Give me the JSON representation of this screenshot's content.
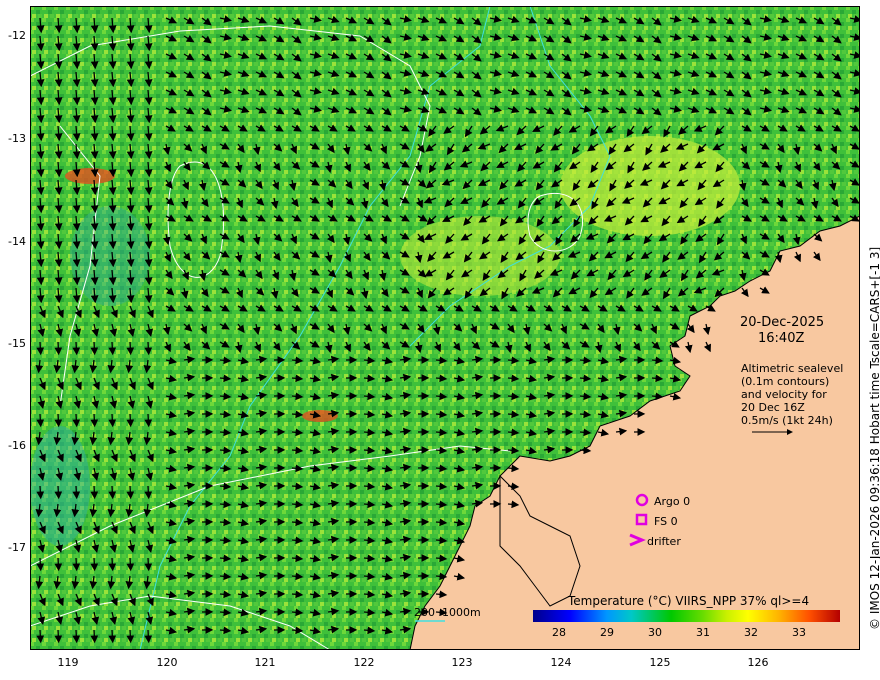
{
  "map": {
    "y_labels": [
      "-12",
      "-13",
      "-14",
      "-15",
      "-16",
      "-17"
    ],
    "x_labels": [
      "119",
      "120",
      "121",
      "122",
      "123",
      "124",
      "125",
      "126"
    ],
    "date": "20-Dec-2025",
    "time": "16:40Z",
    "info_lines": [
      "Altimetric sealevel",
      "(0.1m contours)",
      "and velocity for",
      "20 Dec 16Z",
      "0.5m/s (1kt 24h)"
    ],
    "legend": {
      "argo": "Argo 0",
      "fs": "FS 0",
      "drifter": "drifter"
    },
    "depth_labels": {
      "a": "200",
      "b": "1000m"
    },
    "colorbar_title": "Temperature (°C) VIIRS_NPP 37% ql>=4",
    "colorbar_ticks": [
      "28",
      "29",
      "30",
      "31",
      "32",
      "33"
    ],
    "credit": "© IMOS 12-Jan-2026 09:36:18 Hobart time Tscale=CARS+[-1 3]",
    "colors": {
      "land": "#f8c8a0",
      "ocean": "#44c83c",
      "contour": "#ffffff",
      "bathy": "#40e0e0",
      "marker": "#e000e0"
    }
  }
}
